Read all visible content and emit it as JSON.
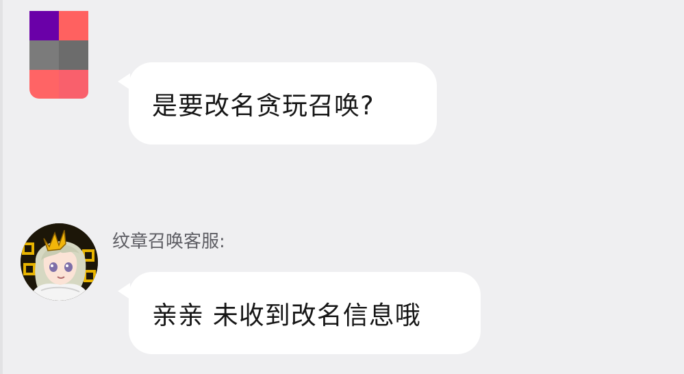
{
  "messages": [
    {
      "sender": "",
      "avatar": "pixel-avatar",
      "text": "是要改名贪玩召唤?"
    },
    {
      "sender": "纹章召唤客服:",
      "avatar": "anime-character-avatar",
      "text": "亲亲 未收到改名信息哦"
    }
  ],
  "colors": {
    "background": "#efeff1",
    "bubble": "#ffffff",
    "text": "#161616",
    "sender_name": "#5d5d63"
  }
}
